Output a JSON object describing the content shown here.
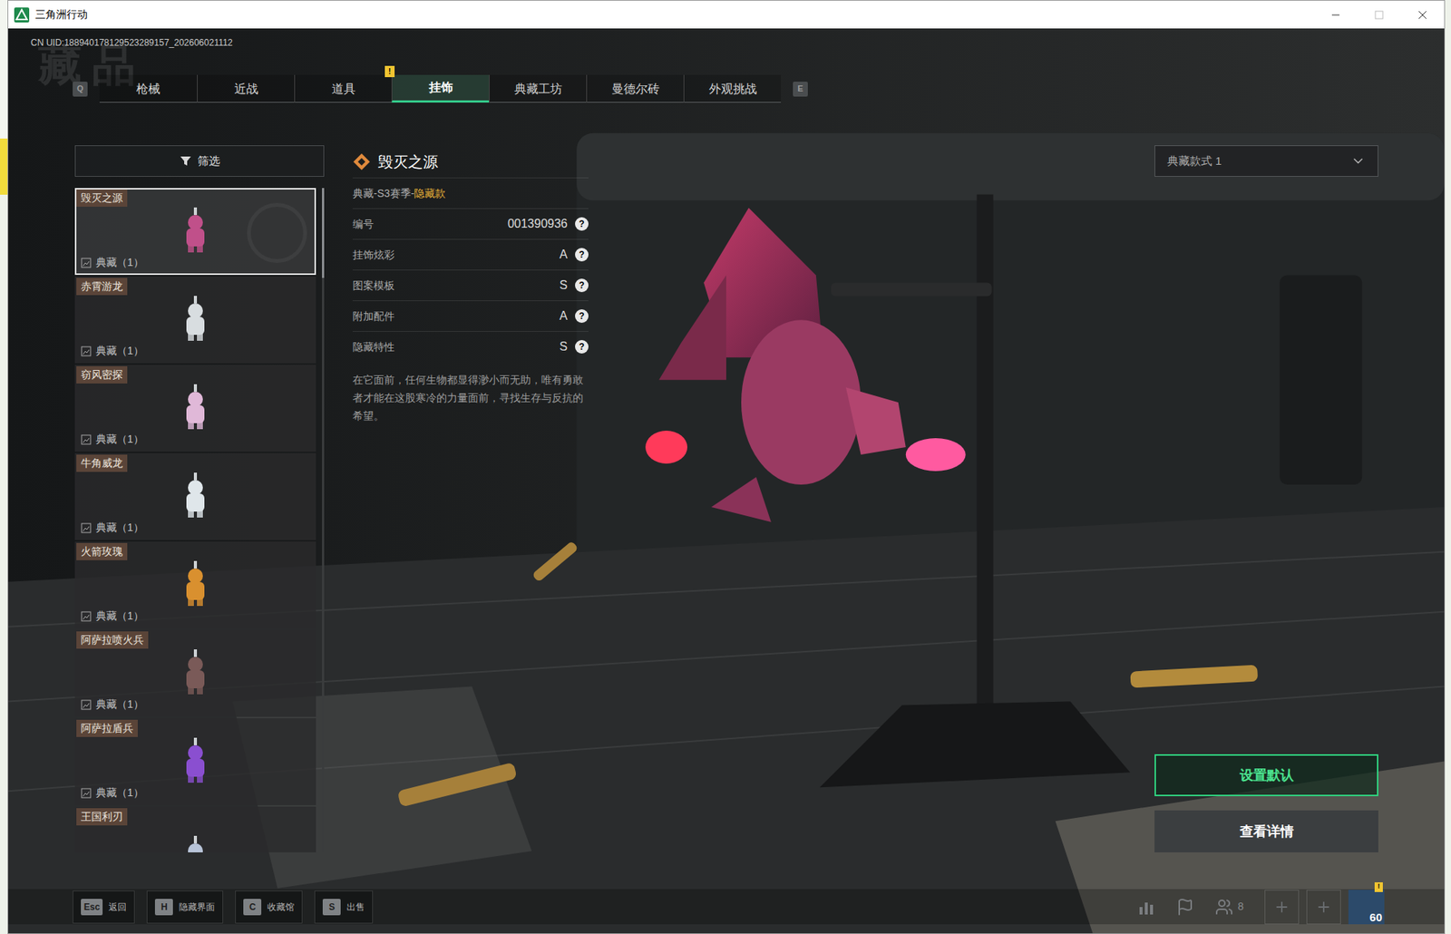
{
  "window": {
    "title": "三角洲行动"
  },
  "uid": "CN UID:188940178129523289157_202606021112",
  "watermark": "藏品",
  "tabs": {
    "prev_key": "Q",
    "next_key": "E",
    "items": [
      {
        "label": "枪械",
        "selected": false,
        "badge": null
      },
      {
        "label": "近战",
        "selected": false,
        "badge": null
      },
      {
        "label": "道具",
        "selected": false,
        "badge": null
      },
      {
        "label": "挂饰",
        "selected": true,
        "badge": "!"
      },
      {
        "label": "典藏工坊",
        "selected": false,
        "badge": null
      },
      {
        "label": "曼德尔砖",
        "selected": false,
        "badge": null
      },
      {
        "label": "外观挑战",
        "selected": false,
        "badge": null
      }
    ]
  },
  "filter": {
    "label": "筛选"
  },
  "collection": [
    {
      "name": "毁灭之源",
      "tag": "典藏（1）",
      "selected": true,
      "color": "#c0508a"
    },
    {
      "name": "赤霄游龙",
      "tag": "典藏（1）",
      "selected": false,
      "color": "#d8dde0"
    },
    {
      "name": "窃风密探",
      "tag": "典藏（1）",
      "selected": false,
      "color": "#e0b8d8"
    },
    {
      "name": "牛角威龙",
      "tag": "典藏（1）",
      "selected": false,
      "color": "#dfe6ea"
    },
    {
      "name": "火箭玫瑰",
      "tag": "典藏（1）",
      "selected": false,
      "color": "#d9902f"
    },
    {
      "name": "阿萨拉喷火兵",
      "tag": "典藏（1）",
      "selected": false,
      "color": "#7a5a58"
    },
    {
      "name": "阿萨拉盾兵",
      "tag": "典藏（1）",
      "selected": false,
      "color": "#8a4fd0"
    },
    {
      "name": "王国利刃",
      "tag": null,
      "selected": false,
      "color": "#b8c4d8"
    }
  ],
  "detail": {
    "name": "毁灭之源",
    "series": "典藏-S3赛季-",
    "rarity": "隐藏款",
    "stats": [
      {
        "label": "编号",
        "value": "001390936",
        "help": "?"
      },
      {
        "label": "挂饰炫彩",
        "value": "A",
        "help": "?"
      },
      {
        "label": "图案模板",
        "value": "S",
        "help": "?"
      },
      {
        "label": "附加配件",
        "value": "A",
        "help": "?"
      },
      {
        "label": "隐藏特性",
        "value": "S",
        "help": "?"
      }
    ],
    "description": "在它面前，任何生物都显得渺小而无助，唯有勇敢者才能在这股寒冷的力量面前，寻找生存与反抗的希望。"
  },
  "style_select": {
    "value": "典藏款式 1"
  },
  "actions": [
    {
      "label": "设置默认",
      "primary": true
    },
    {
      "label": "查看详情",
      "primary": false
    }
  ],
  "hotkeys": [
    {
      "key": "Esc",
      "label": "返回"
    },
    {
      "key": "H",
      "label": "隐藏界面"
    },
    {
      "key": "C",
      "label": "收藏馆"
    },
    {
      "key": "S",
      "label": "出售"
    }
  ],
  "status": {
    "friends": "8",
    "level": "60",
    "alert": "!"
  }
}
